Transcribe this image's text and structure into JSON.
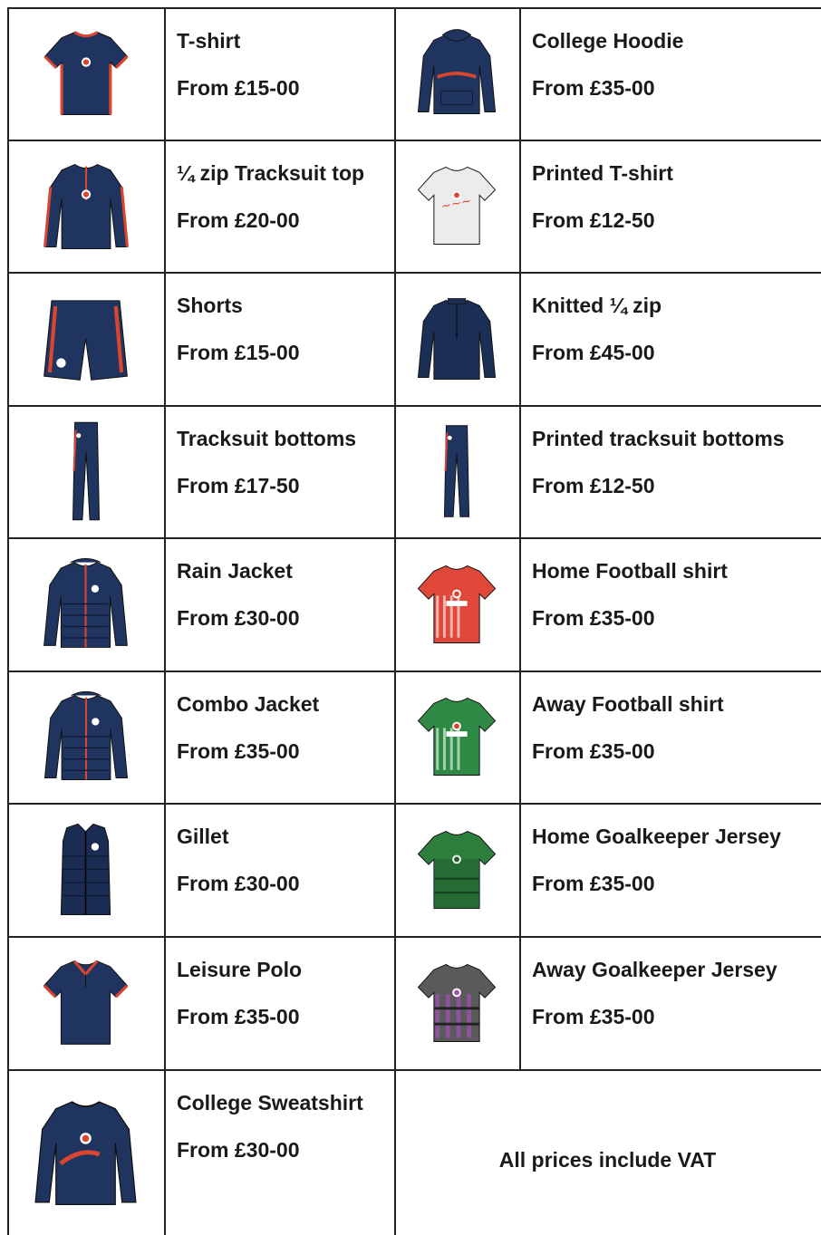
{
  "products": [
    {
      "name": "T-shirt",
      "price": "From £15-00",
      "icon": "tshirt-icon",
      "base": "#1f3560",
      "accent": "#d9452f"
    },
    {
      "name": "College Hoodie",
      "price": "From £35-00",
      "icon": "hoodie-icon",
      "base": "#1f3560",
      "accent": "#d9452f"
    },
    {
      "name": "¼ zip Tracksuit top",
      "price": "From £20-00",
      "icon": "quarter-zip-top-icon",
      "base": "#1f3560",
      "accent": "#d9452f"
    },
    {
      "name": "Printed T-shirt",
      "price": "From £12-50",
      "icon": "printed-tshirt-icon",
      "base": "#ececec",
      "accent": "#d9452f"
    },
    {
      "name": "Shorts",
      "price": "From £15-00",
      "icon": "shorts-icon",
      "base": "#1f3560",
      "accent": "#d9452f"
    },
    {
      "name": "Knitted ¼ zip",
      "price": "From £45-00",
      "icon": "knitted-zip-icon",
      "base": "#1b2e54",
      "accent": "#1b2e54"
    },
    {
      "name": "Tracksuit bottoms",
      "price": "From £17-50",
      "icon": "tracksuit-bottoms-icon",
      "base": "#1f3560",
      "accent": "#d9452f"
    },
    {
      "name": "Printed tracksuit bottoms",
      "price": "From £12-50",
      "icon": "printed-bottoms-icon",
      "base": "#1f3560",
      "accent": "#d9452f"
    },
    {
      "name": "Rain Jacket",
      "price": "From £30-00",
      "icon": "rain-jacket-icon",
      "base": "#1f3560",
      "accent": "#d9452f"
    },
    {
      "name": "Home Football shirt",
      "price": "From £35-00",
      "icon": "home-football-shirt-icon",
      "base": "#e0493a",
      "accent": "#ffffff"
    },
    {
      "name": "Combo Jacket",
      "price": "From £35-00",
      "icon": "combo-jacket-icon",
      "base": "#1f3560",
      "accent": "#d9452f"
    },
    {
      "name": "Away Football shirt",
      "price": "From £35-00",
      "icon": "away-football-shirt-icon",
      "base": "#2f8a45",
      "accent": "#ffffff"
    },
    {
      "name": "Gillet",
      "price": "From £30-00",
      "icon": "gillet-icon",
      "base": "#1a2c52",
      "accent": "#d9452f"
    },
    {
      "name": "Home Goalkeeper Jersey",
      "price": "From £35-00",
      "icon": "home-goalkeeper-jersey-icon",
      "base": "#2d7d3d",
      "accent": "#1f5a2b"
    },
    {
      "name": "Leisure Polo",
      "price": "From £35-00",
      "icon": "polo-icon",
      "base": "#1f3560",
      "accent": "#d9452f"
    },
    {
      "name": "Away Goalkeeper Jersey",
      "price": "From £35-00",
      "icon": "away-goalkeeper-jersey-icon",
      "base": "#5a5a5a",
      "accent": "#9b4fb0"
    },
    {
      "name": "College Sweatshirt",
      "price": "From £30-00",
      "icon": "sweatshirt-icon",
      "base": "#1f3560",
      "accent": "#d9452f"
    }
  ],
  "note": "All prices include VAT"
}
